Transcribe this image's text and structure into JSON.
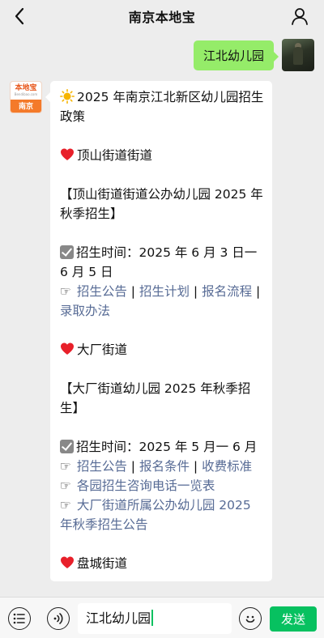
{
  "header": {
    "title": "南京本地宝",
    "back_icon": "chevron-left-icon",
    "profile_icon": "person-icon"
  },
  "chat": {
    "user_message": "江北幼儿园",
    "bot_avatar": {
      "logo_text": "本地宝",
      "logo_subtext": "Bendibao.com",
      "city": "南京"
    },
    "bot_message": {
      "title": "2025 年南京江北新区幼儿园招生政策",
      "sections": [
        {
          "district": "顶山街道街道",
          "heading": "【顶山街道街道公办幼儿园 2025 年秋季招生】",
          "time_text": "招生时间：2025 年 6 月 3 日一6 月 5 日",
          "links_line1": [
            "招生公告",
            "招生计划",
            "报名流程"
          ],
          "links_line2": [
            "录取办法"
          ]
        },
        {
          "district": "大厂街道",
          "heading": "【大厂街道幼儿园 2025 年秋季招生】",
          "time_text": "招生时间：2025 年 5 月一 6 月",
          "links_line1": [
            "招生公告",
            "报名条件",
            "收费标准"
          ],
          "extra_links": [
            "各园招生咨询电话一览表",
            "大厂街道所属公办幼儿园 2025 年秋季招生公告"
          ]
        },
        {
          "district": "盘城街道"
        }
      ]
    }
  },
  "footer": {
    "input_value": "江北幼儿园",
    "send_label": "发送",
    "left_icon": "list-icon",
    "voice_icon": "voice-icon",
    "emoji_icon": "emoji-icon",
    "accent_color": "#07c160"
  }
}
